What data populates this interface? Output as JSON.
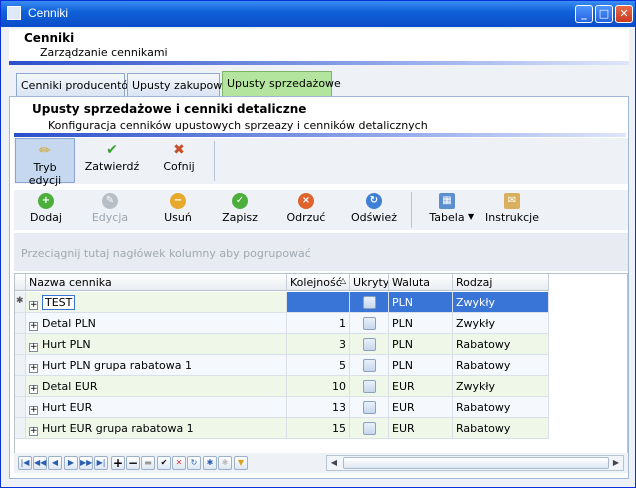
{
  "window": {
    "title": "Cenniki",
    "min": "_",
    "max": "□",
    "close": "✕"
  },
  "header": {
    "title": "Cenniki",
    "subtitle": "Zarządzanie cennikami"
  },
  "tabs": [
    {
      "label": "Cenniki producentów"
    },
    {
      "label": "Upusty zakupowe"
    },
    {
      "label": "Upusty sprzedażowe"
    }
  ],
  "panel": {
    "title": "Upusty sprzedażowe i cenniki detaliczne",
    "subtitle": "Konfiguracja cenników upustowych sprzeazy i cenników detalicznych"
  },
  "toolbar1": [
    {
      "label": "Tryb edycji",
      "icon": "pencil-icon",
      "glyph": "✏"
    },
    {
      "label": "Zatwierdź",
      "icon": "check-icon",
      "glyph": "✔"
    },
    {
      "label": "Cofnij",
      "icon": "undo-icon",
      "glyph": "✖"
    }
  ],
  "toolbar2": [
    {
      "label": "Dodaj",
      "icon": "add-icon",
      "glyph": "+"
    },
    {
      "label": "Edycja",
      "icon": "edit-icon",
      "glyph": "✎"
    },
    {
      "label": "Usuń",
      "icon": "delete-icon",
      "glyph": "−"
    },
    {
      "label": "Zapisz",
      "icon": "save-icon",
      "glyph": "✓"
    },
    {
      "label": "Odrzuć",
      "icon": "discard-icon",
      "glyph": "×"
    },
    {
      "label": "Odśwież",
      "icon": "refresh-icon",
      "glyph": "↻"
    },
    {
      "label": "Tabela",
      "icon": "table-icon",
      "glyph": "▦"
    },
    {
      "label": "Instrukcje",
      "icon": "instructions-icon",
      "glyph": "✉"
    }
  ],
  "groupbar": {
    "text": "Przeciągnij tutaj nagłówek kolumny aby pogrupować"
  },
  "grid": {
    "columns": [
      "Nazwa cennika",
      "Kolejność",
      "Ukryty",
      "Waluta",
      "Rodzaj"
    ],
    "rows": [
      {
        "name": "TEST",
        "order": "",
        "currency": "PLN",
        "type": "Zwykły"
      },
      {
        "name": "Detal PLN",
        "order": "1",
        "currency": "PLN",
        "type": "Zwykły"
      },
      {
        "name": "Hurt PLN",
        "order": "3",
        "currency": "PLN",
        "type": "Rabatowy"
      },
      {
        "name": "Hurt PLN grupa rabatowa 1",
        "order": "5",
        "currency": "PLN",
        "type": "Rabatowy"
      },
      {
        "name": "Detal EUR",
        "order": "10",
        "currency": "EUR",
        "type": "Zwykły"
      },
      {
        "name": "Hurt EUR",
        "order": "13",
        "currency": "EUR",
        "type": "Rabatowy"
      },
      {
        "name": "Hurt EUR grupa rabatowa 1",
        "order": "15",
        "currency": "EUR",
        "type": "Rabatowy"
      }
    ]
  },
  "colors": {
    "accent": "#3875d7",
    "active_tab": "#b4e59e"
  }
}
